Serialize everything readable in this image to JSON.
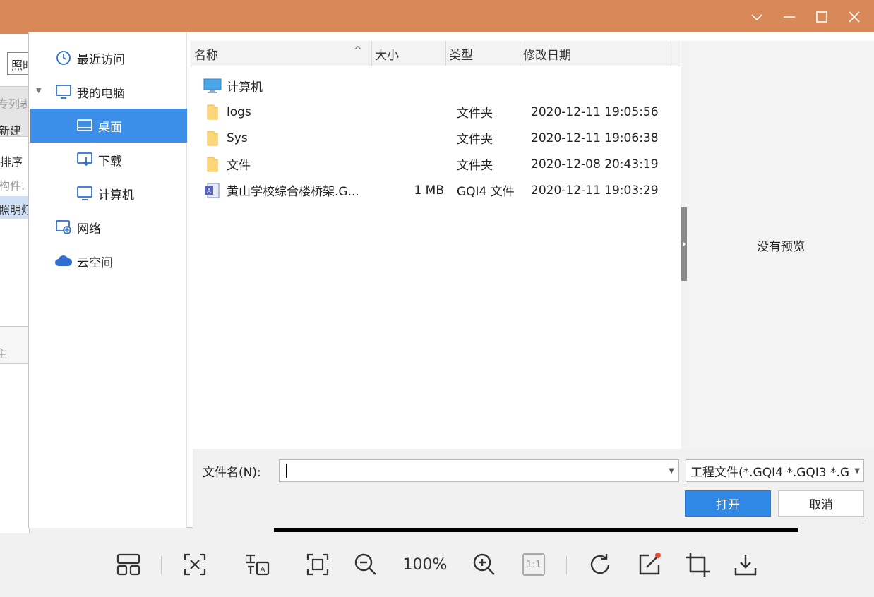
{
  "background_app": {
    "items": [
      "照时",
      "专列表",
      "新建",
      "排序",
      "构件.",
      "照明灯",
      "主"
    ]
  },
  "titlebar": {
    "icons": [
      "chevron-down-icon",
      "minimize-icon",
      "maximize-icon",
      "close-icon"
    ]
  },
  "nav": {
    "items": [
      {
        "label": "最近访问",
        "icon": "clock-icon"
      },
      {
        "label": "我的电脑",
        "icon": "monitor-icon"
      },
      {
        "label": "桌面",
        "icon": "desktop-icon"
      },
      {
        "label": "下载",
        "icon": "download-icon"
      },
      {
        "label": "计算机",
        "icon": "monitor-icon"
      },
      {
        "label": "网络",
        "icon": "network-icon"
      },
      {
        "label": "云空间",
        "icon": "cloud-icon"
      }
    ],
    "selected": "桌面"
  },
  "list": {
    "columns": [
      "名称",
      "大小",
      "类型",
      "修改日期"
    ],
    "sort_indicator": "^",
    "rows": [
      {
        "name": "计算机",
        "size": "",
        "type": "",
        "date": "",
        "icon": "computer-icon"
      },
      {
        "name": "logs",
        "size": "",
        "type": "文件夹",
        "date": "2020-12-11 19:05:56",
        "icon": "folder-icon"
      },
      {
        "name": "Sys",
        "size": "",
        "type": "文件夹",
        "date": "2020-12-11 19:06:38",
        "icon": "folder-icon"
      },
      {
        "name": "文件",
        "size": "",
        "type": "文件夹",
        "date": "2020-12-08 20:43:19",
        "icon": "folder-icon"
      },
      {
        "name": "黄山学校综合楼桥架.G...",
        "size": "1 MB",
        "type": "GQI4 文件",
        "date": "2020-12-11 19:03:29",
        "icon": "gqi-file-icon"
      }
    ]
  },
  "preview": {
    "text": "没有预览"
  },
  "bottom": {
    "filename_label": "文件名(N):",
    "filename_value": "",
    "filter": "工程文件(*.GQI4 *.GQI3 *.G",
    "open_label": "打开",
    "cancel_label": "取消"
  },
  "viewer": {
    "zoom": "100%",
    "one_to_one": "1:1"
  }
}
